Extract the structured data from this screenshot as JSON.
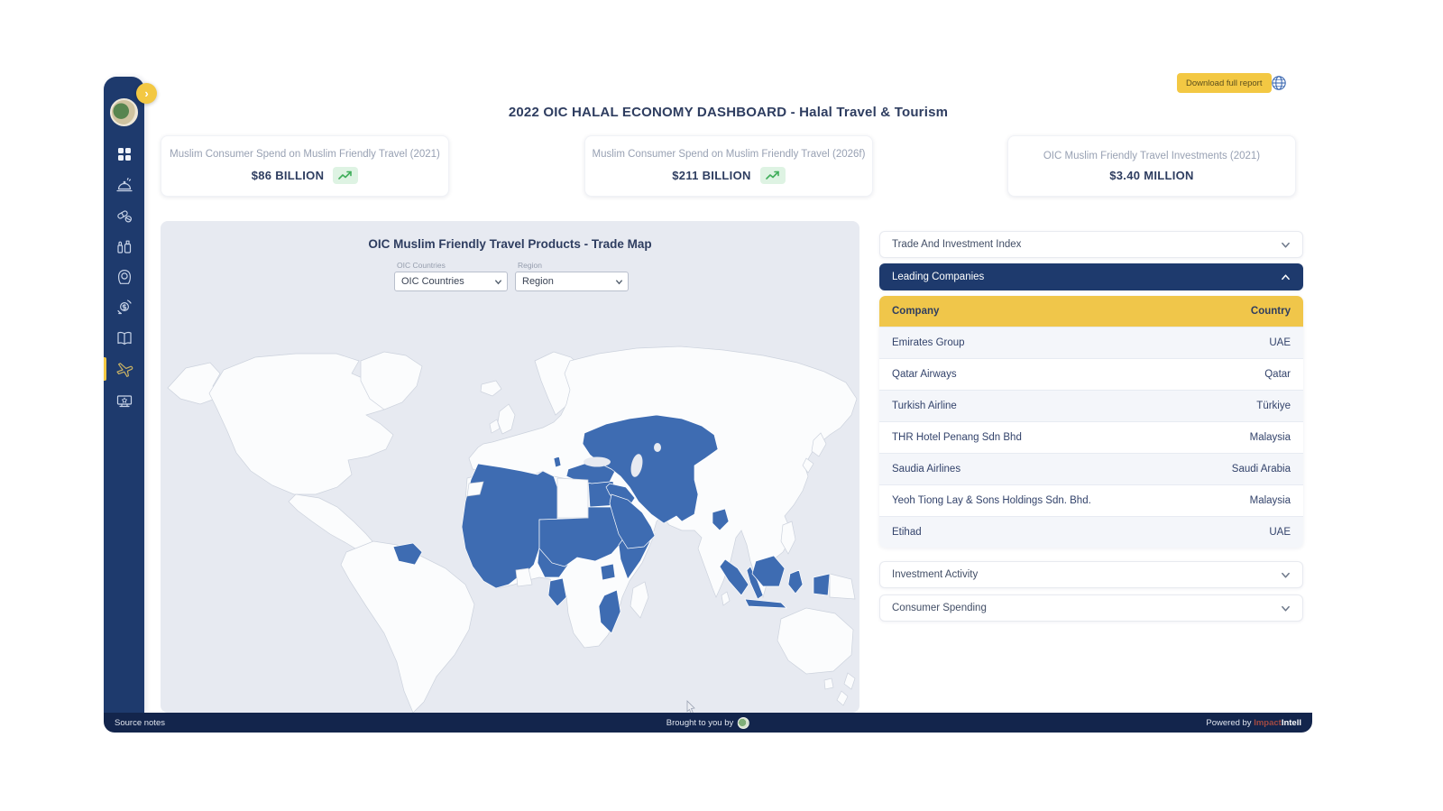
{
  "colors": {
    "navy_sidebar": "#1e3a6d",
    "navy_footer": "#13254c",
    "navy_text": "#2e3d60",
    "accent_yellow": "#f3c843",
    "table_header_yellow": "#f0c64a",
    "map_bg": "#e7eaf1",
    "land": "#fbfcfd",
    "land_border": "#ccd2dd",
    "oic_blue": "#3e6cb2",
    "green_trend": "#3fae5a",
    "green_trend_bg": "#def3e3",
    "brand_red": "#a34a42"
  },
  "header": {
    "title": "2022 OIC HALAL ECONOMY DASHBOARD - Halal Travel & Tourism",
    "download_label": "Download full report"
  },
  "sidebar": {
    "expand_glyph": "›",
    "items": [
      {
        "icon": "dashboard-grid-icon"
      },
      {
        "icon": "halal-food-icon"
      },
      {
        "icon": "pharmaceuticals-icon"
      },
      {
        "icon": "cosmetics-icon"
      },
      {
        "icon": "modest-fashion-icon"
      },
      {
        "icon": "islamic-finance-icon"
      },
      {
        "icon": "media-book-icon"
      },
      {
        "icon": "travel-tourism-icon",
        "active": true
      },
      {
        "icon": "media-screen-icon"
      }
    ]
  },
  "stat_cards": [
    {
      "label": "Muslim Consumer Spend on Muslim Friendly Travel (2021)",
      "value": "$86 BILLION",
      "trend": true
    },
    {
      "label": "Muslim Consumer Spend on Muslim Friendly Travel (2026f)",
      "value": "$211 BILLION",
      "trend": true
    },
    {
      "label": "OIC Muslim Friendly Travel Investments (2021)",
      "value": "$3.40 MILLION",
      "trend": false
    }
  ],
  "map_panel": {
    "title": "OIC Muslim Friendly Travel Products - Trade Map",
    "filters": [
      {
        "label": "OIC Countries",
        "value": "OIC Countries"
      },
      {
        "label": "Region",
        "value": "Region"
      }
    ]
  },
  "accordion": {
    "trade_index": "Trade And Investment Index",
    "leading_companies": "Leading Companies",
    "investment_activity": "Investment Activity",
    "consumer_spending": "Consumer Spending"
  },
  "companies_table": {
    "headers": {
      "company": "Company",
      "country": "Country"
    },
    "rows": [
      {
        "company": "Emirates Group",
        "country": "UAE"
      },
      {
        "company": "Qatar Airways",
        "country": "Qatar"
      },
      {
        "company": "Turkish Airline",
        "country": "Türkiye"
      },
      {
        "company": "THR Hotel Penang Sdn Bhd",
        "country": "Malaysia"
      },
      {
        "company": "Saudia Airlines",
        "country": "Saudi Arabia"
      },
      {
        "company": "Yeoh Tiong Lay & Sons Holdings Sdn. Bhd.",
        "country": "Malaysia"
      },
      {
        "company": "Etihad",
        "country": "UAE"
      }
    ]
  },
  "footer": {
    "source_notes": "Source notes",
    "brought_by": "Brought to you by",
    "powered_by": "Powered by",
    "brand_impact": "Impact",
    "brand_intell": "Intell"
  }
}
